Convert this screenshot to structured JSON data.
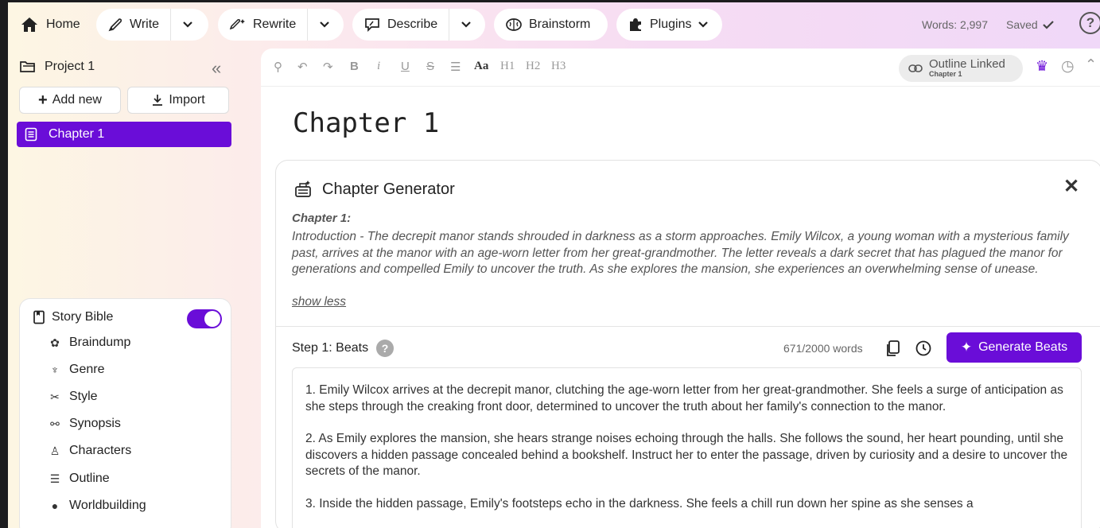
{
  "topbar": {
    "home_label": "Home",
    "write_label": "Write",
    "rewrite_label": "Rewrite",
    "describe_label": "Describe",
    "brainstorm_label": "Brainstorm",
    "plugins_label": "Plugins",
    "words": "Words: 2,997",
    "saved": "Saved",
    "help": "?"
  },
  "sidebar": {
    "project": "Project 1",
    "add_new": "Add new",
    "import": "Import",
    "chapters": [
      "Chapter 1"
    ],
    "story_bible": {
      "title": "Story Bible",
      "enabled": true,
      "items": [
        {
          "label": "Braindump",
          "icon": "brain-icon"
        },
        {
          "label": "Genre",
          "icon": "genre-icon"
        },
        {
          "label": "Style",
          "icon": "style-icon"
        },
        {
          "label": "Synopsis",
          "icon": "synopsis-icon"
        },
        {
          "label": "Characters",
          "icon": "characters-icon"
        },
        {
          "label": "Outline",
          "icon": "list-icon"
        },
        {
          "label": "Worldbuilding",
          "icon": "globe-icon"
        }
      ]
    }
  },
  "toolbar": {
    "aa": "Aa",
    "h1": "H1",
    "h2": "H2",
    "h3": "H3",
    "outline_linked": "Outline Linked",
    "outline_chapter": "Chapter 1"
  },
  "editor": {
    "title": "Chapter 1"
  },
  "generator": {
    "title": "Chapter Generator",
    "chapter_label": "Chapter 1:",
    "chapter_desc": "Introduction - The decrepit manor stands shrouded in darkness as a storm approaches. Emily Wilcox, a young woman with a mysterious family past, arrives at the manor with an age-worn letter from her great-grandmother. The letter reveals a dark secret that has plagued the manor for generations and compelled Emily to uncover the truth. As she explores the mansion, she experiences an overwhelming sense of unease.",
    "show_less": "show less",
    "step_label": "Step 1: Beats",
    "word_count": "671/2000 words",
    "generate_label": "Generate Beats",
    "beats": [
      "1. Emily Wilcox arrives at the decrepit manor, clutching the age-worn letter from her great-grandmother. She feels a surge of anticipation as she steps through the creaking front door, determined to uncover the truth about her family's connection to the manor.",
      "2. As Emily explores the mansion, she hears strange noises echoing through the halls. She follows the sound, her heart pounding, until she discovers a hidden passage concealed behind a bookshelf. Instruct her to enter the passage, driven by curiosity and a desire to uncover the secrets of the manor.",
      "3. Inside the hidden passage, Emily's footsteps echo in the darkness. She feels a chill run down her spine as she senses a"
    ]
  },
  "colors": {
    "accent": "#6a0dd8"
  }
}
